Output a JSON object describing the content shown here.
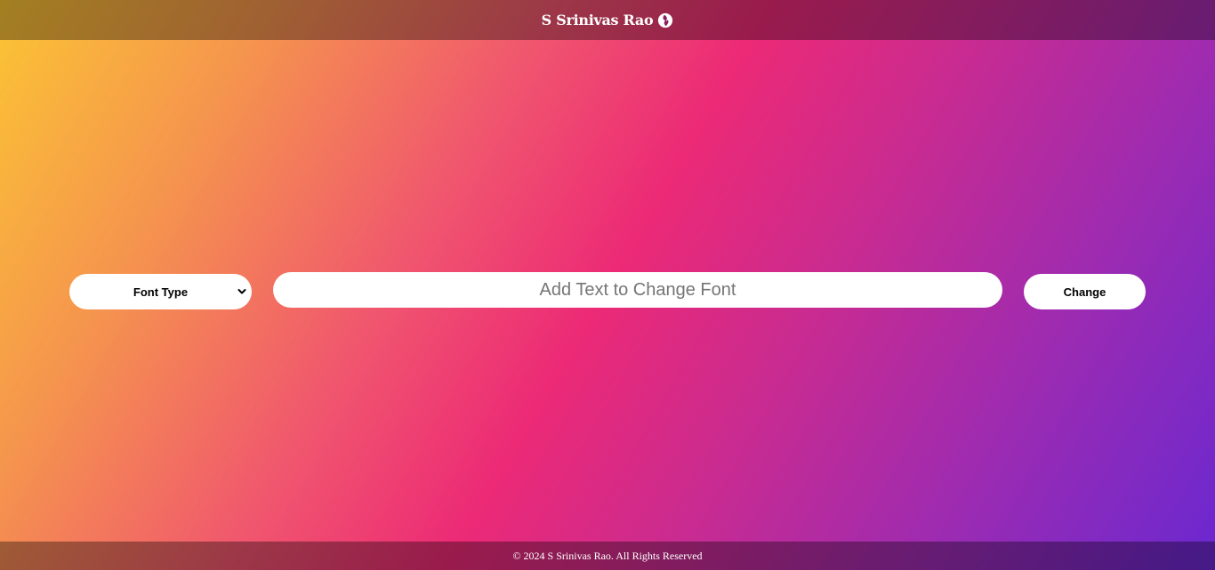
{
  "header": {
    "brand_name": "S Srinivas Rao",
    "brand_icon": "fire-leaf-icon"
  },
  "controls": {
    "font_select": {
      "selected_label": "Font Type",
      "arrow_icon": "chevron-down-icon"
    },
    "text_input": {
      "value": "",
      "placeholder": "Add Text to Change Font"
    },
    "change_button_label": "Change"
  },
  "footer": {
    "copyright": "© 2024 S Srinivas Rao. All Rights Reserved"
  },
  "colors": {
    "gradient_start": "#fbc434",
    "gradient_mid": "#ec2a76",
    "gradient_end": "#6a28d0",
    "control_bg": "#ffffff"
  }
}
